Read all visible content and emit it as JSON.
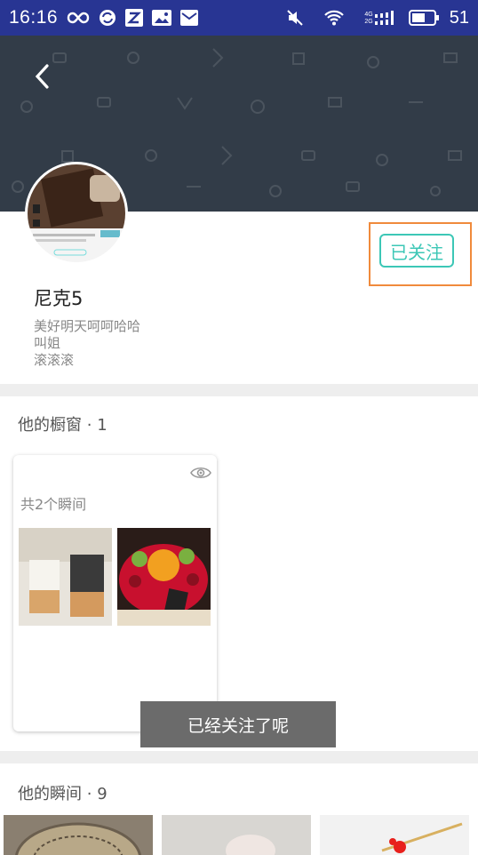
{
  "status_bar": {
    "time": "16:16",
    "battery_level": "51",
    "network_labels": [
      "4G",
      "2G"
    ],
    "background_color": "#283593"
  },
  "header": {
    "back_icon": "chevron-left-icon"
  },
  "profile": {
    "name": "尼克5",
    "bio_lines": [
      "美好明天呵呵哈哈",
      "叫姐",
      "滚滚滚"
    ],
    "follow_label": "已关注",
    "accent_color": "#3cc7b6",
    "highlight_color": "#f08a3c"
  },
  "showcase": {
    "title": "他的橱窗",
    "separator": "·",
    "count": "1",
    "card": {
      "moments_label": "共2个瞬间",
      "eye_icon": "eye-icon"
    }
  },
  "moments": {
    "title": "他的瞬间",
    "separator": "·",
    "count": "9"
  },
  "toast": {
    "message": "已经关注了呢"
  }
}
